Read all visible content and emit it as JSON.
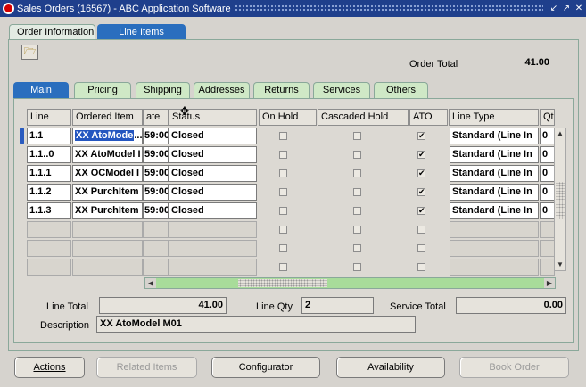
{
  "window": {
    "title": "Sales Orders (16567) - ABC Application Software",
    "controls": [
      "↙",
      "↗",
      "✕"
    ]
  },
  "outer_tabs": [
    {
      "label": "Order Information",
      "active": false
    },
    {
      "label": "Line Items",
      "active": true
    }
  ],
  "order_total": {
    "label": "Order Total",
    "value": "41.00"
  },
  "inner_tabs": [
    {
      "label": "Main",
      "active": true
    },
    {
      "label": "Pricing",
      "active": false
    },
    {
      "label": "Shipping",
      "active": false
    },
    {
      "label": "Addresses",
      "active": false
    },
    {
      "label": "Returns",
      "active": false
    },
    {
      "label": "Services",
      "active": false
    },
    {
      "label": "Others",
      "active": false
    }
  ],
  "grid": {
    "columns": [
      "Line",
      "Ordered Item",
      "ate",
      "Status",
      "On Hold",
      "Cascaded Hold",
      "ATO",
      "Line Type",
      "Qt"
    ],
    "rows": [
      {
        "line": "1.1",
        "item": "XX AtoMode",
        "item_more": "...",
        "date": "59:00",
        "status": "Closed",
        "on_hold": false,
        "cascaded_hold": false,
        "ato": true,
        "line_type": "Standard (Line In",
        "qty": "0"
      },
      {
        "line": "1.1..0",
        "item": "XX AtoModel I",
        "item_more": "",
        "date": "59:00",
        "status": "Closed",
        "on_hold": false,
        "cascaded_hold": false,
        "ato": true,
        "line_type": "Standard (Line In",
        "qty": "0"
      },
      {
        "line": "1.1.1",
        "item": "XX OCModel I",
        "item_more": "",
        "date": "59:00",
        "status": "Closed",
        "on_hold": false,
        "cascaded_hold": false,
        "ato": true,
        "line_type": "Standard (Line In",
        "qty": "0"
      },
      {
        "line": "1.1.2",
        "item": "XX PurchItem",
        "item_more": "",
        "date": "59:00",
        "status": "Closed",
        "on_hold": false,
        "cascaded_hold": false,
        "ato": true,
        "line_type": "Standard (Line In",
        "qty": "0"
      },
      {
        "line": "1.1.3",
        "item": "XX PurchItem",
        "item_more": "",
        "date": "59:00",
        "status": "Closed",
        "on_hold": false,
        "cascaded_hold": false,
        "ato": true,
        "line_type": "Standard (Line In",
        "qty": "0"
      }
    ],
    "empty_rows": 3
  },
  "footer": {
    "line_total_label": "Line Total",
    "line_total": "41.00",
    "line_qty_label": "Line Qty",
    "line_qty": "2",
    "service_total_label": "Service Total",
    "service_total": "0.00",
    "description_label": "Description",
    "description": "XX AtoModel M01"
  },
  "buttons": [
    {
      "label": "Actions",
      "enabled": true
    },
    {
      "label": "Related Items",
      "enabled": false
    },
    {
      "label": "Configurator",
      "enabled": true
    },
    {
      "label": "Availability",
      "enabled": true
    },
    {
      "label": "Book Order",
      "enabled": false
    }
  ],
  "colors": {
    "title_bar": "#1f3f8c",
    "active_tab": "#2a6ebe",
    "inactive_tab": "#cfe8c6",
    "selection": "#2456c0"
  }
}
